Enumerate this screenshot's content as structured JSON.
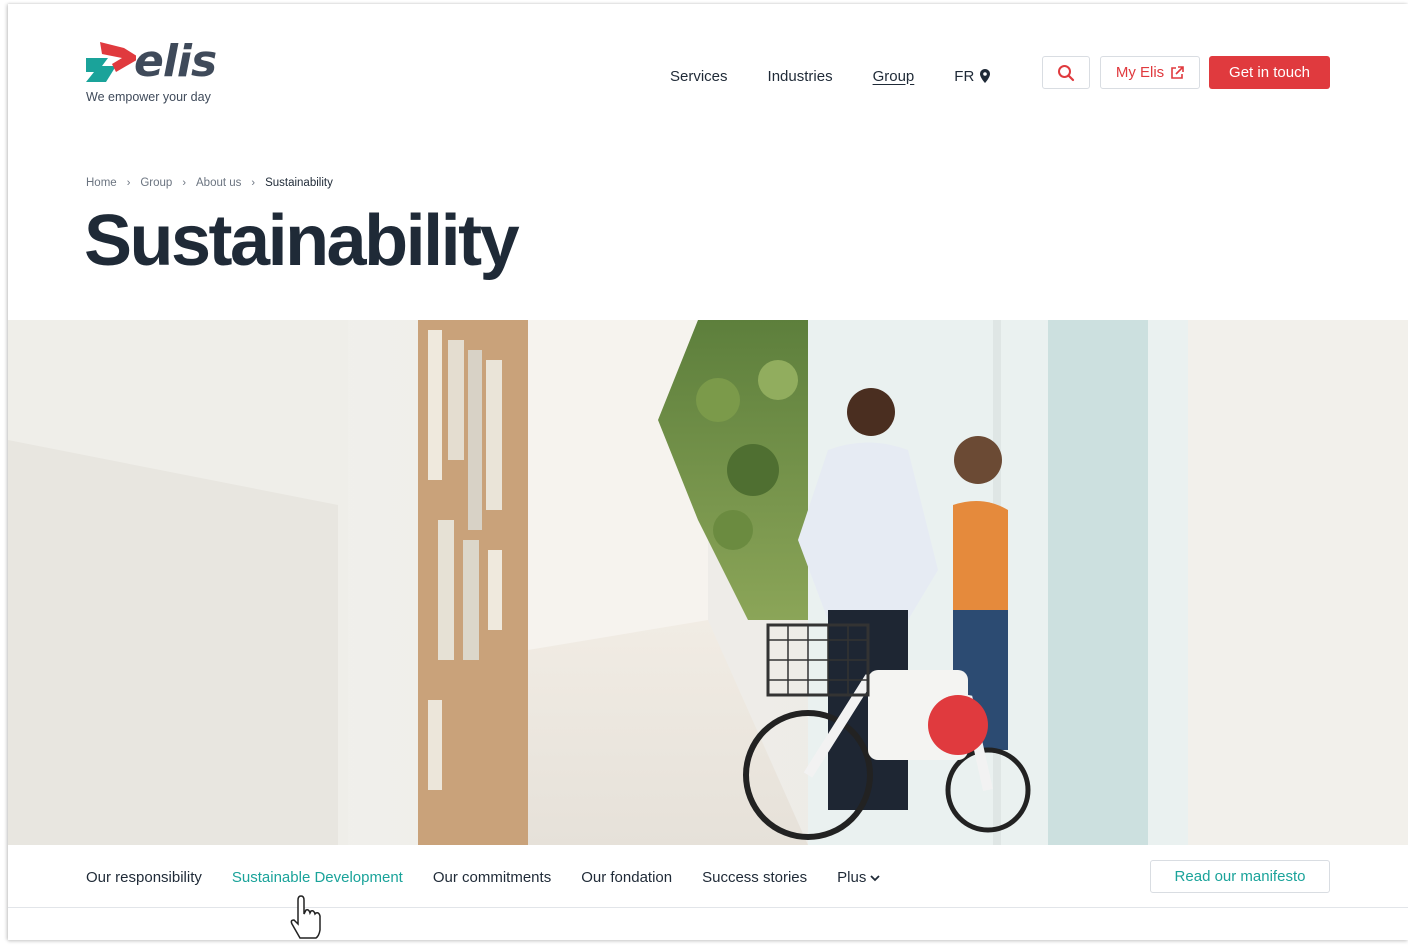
{
  "brand": {
    "name": "elis",
    "tagline": "We empower your day",
    "colors": {
      "red": "#e03a3e",
      "teal": "#1aa39a",
      "dark": "#1f2a37"
    }
  },
  "nav": {
    "items": [
      {
        "label": "Services"
      },
      {
        "label": "Industries"
      },
      {
        "label": "Group",
        "active": true
      }
    ],
    "lang": "FR",
    "lang_icon": "location-pin-icon",
    "search_icon": "search-icon",
    "my_elis": "My Elis",
    "my_elis_icon": "external-link-icon",
    "cta": "Get in touch"
  },
  "breadcrumb": [
    "Home",
    "Group",
    "About us",
    "Sustainability"
  ],
  "page_title": "Sustainability",
  "hero": {
    "image": "two-men-with-bicycle-in-office-corridor"
  },
  "subnav": {
    "items": [
      {
        "label": "Our responsibility"
      },
      {
        "label": "Sustainable Development",
        "active": true
      },
      {
        "label": "Our commitments"
      },
      {
        "label": "Our fondation"
      },
      {
        "label": "Success stories"
      },
      {
        "label": "Plus"
      }
    ],
    "manifesto": "Read our manifesto"
  }
}
